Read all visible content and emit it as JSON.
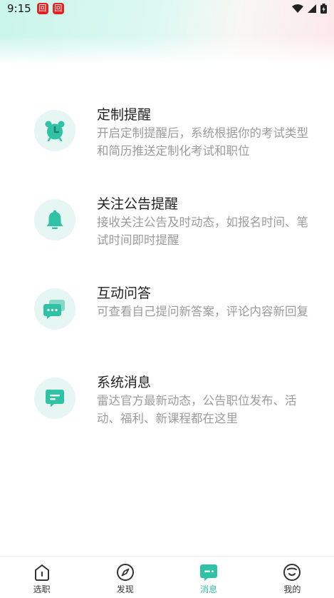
{
  "status_bar": {
    "time": "9:15",
    "notification_badges": [
      "回",
      "回"
    ]
  },
  "items": [
    {
      "icon": "alarm-clock-icon",
      "title": "定制提醒",
      "description": "开启定制提醒后，系统根据你的考试类型和简历推送定制化考试和职位"
    },
    {
      "icon": "bell-icon",
      "title": "关注公告提醒",
      "description": "接收关注公告及时动态，如报名时间、笔试时间即时提醒"
    },
    {
      "icon": "chat-bubbles-icon",
      "title": "互动问答",
      "description": "可查看自己提问新答案，评论内容新回复"
    },
    {
      "icon": "message-icon",
      "title": "系统消息",
      "description": "雷达官方最新动态，公告职位发布、活动、福利、新课程都在这里"
    }
  ],
  "tab_bar": {
    "tabs": [
      {
        "label": "选职",
        "icon": "home-icon",
        "active": false
      },
      {
        "label": "发现",
        "icon": "compass-icon",
        "active": false
      },
      {
        "label": "消息",
        "icon": "message-icon",
        "active": true
      },
      {
        "label": "我的",
        "icon": "profile-icon",
        "active": false
      }
    ]
  },
  "colors": {
    "accent": "#2fc2a4",
    "icon_bg": "#e6f6f2",
    "desc_text": "#9b9b9b"
  }
}
